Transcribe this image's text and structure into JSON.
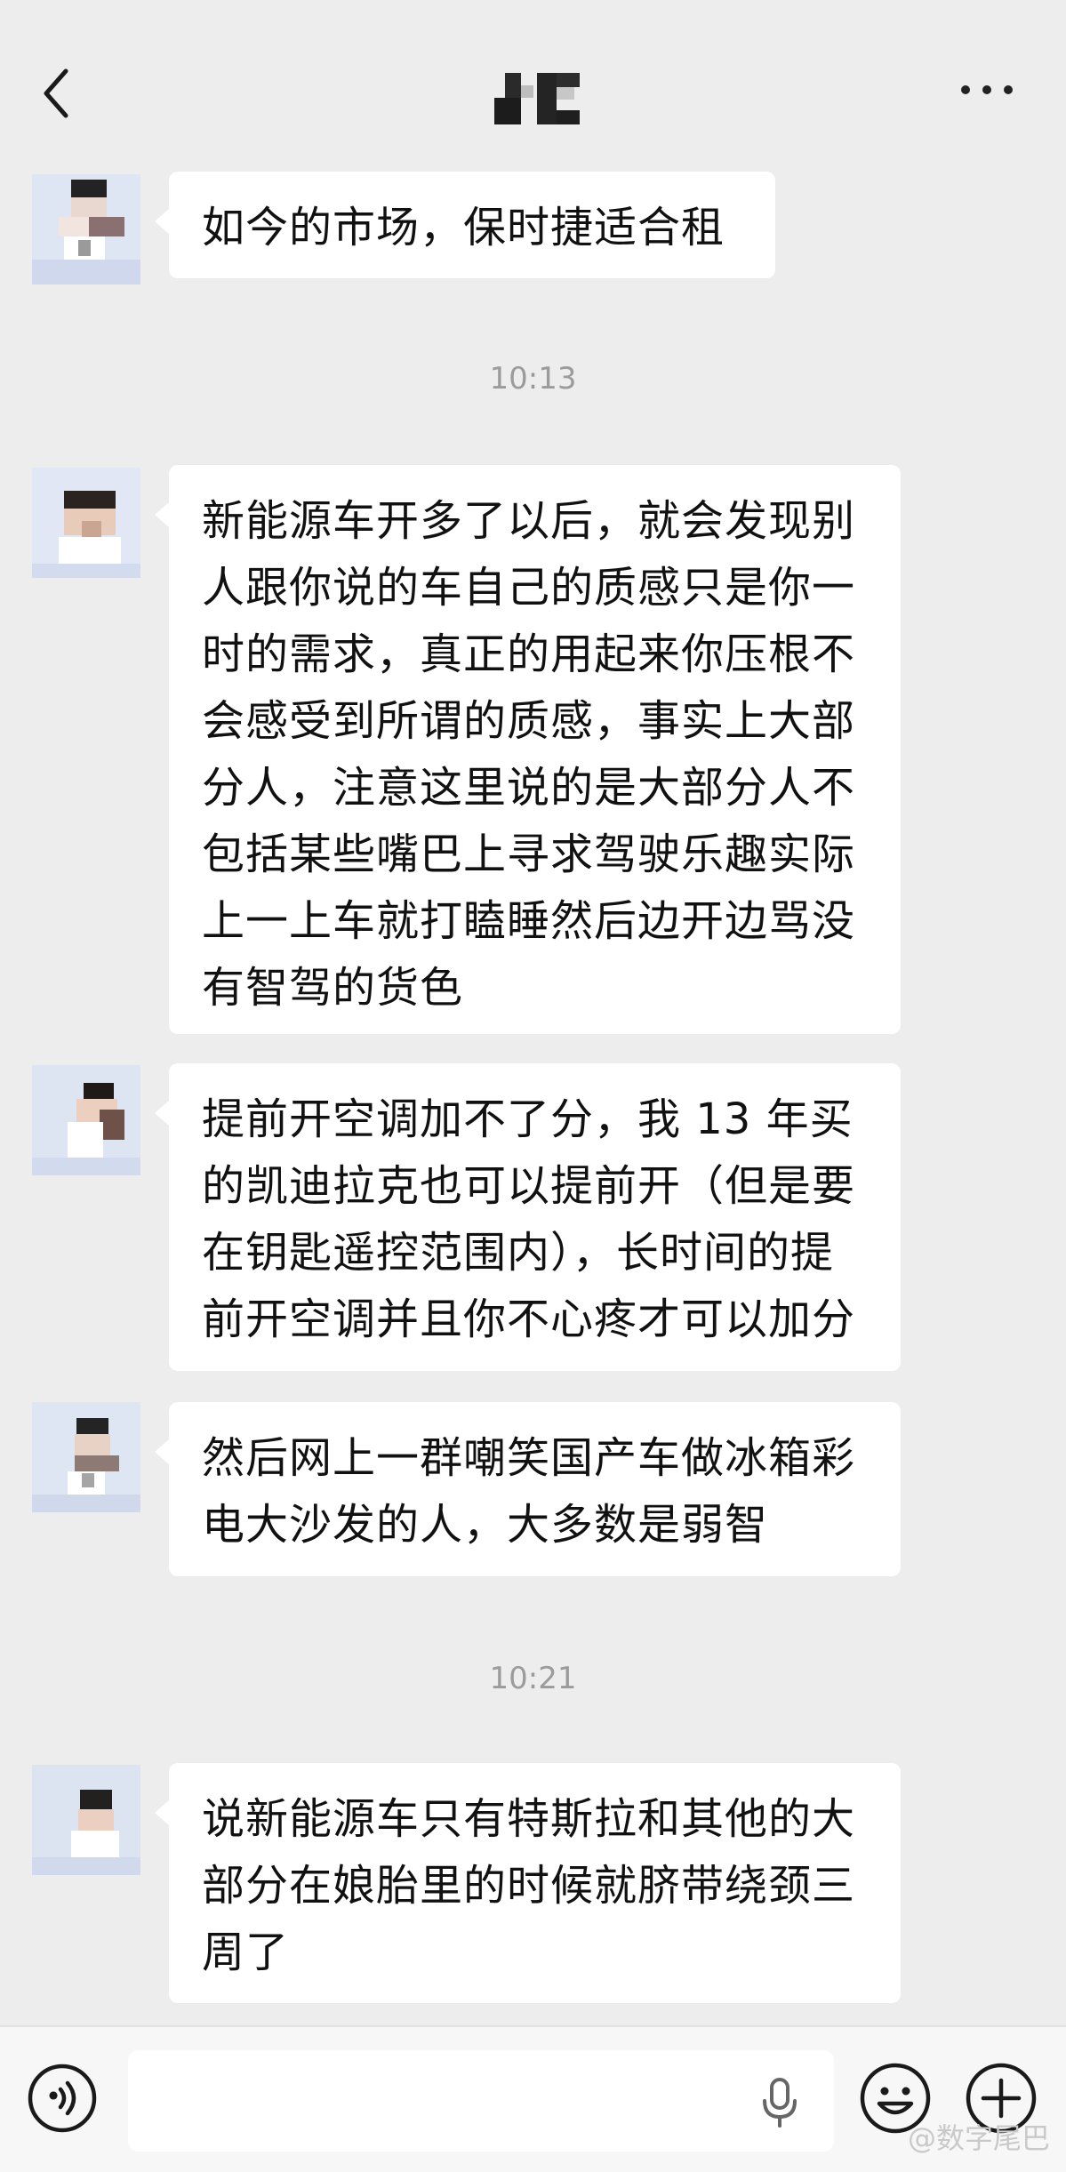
{
  "header": {
    "back_icon": "chevron-left-icon",
    "title_icon": "pixelated-contact-name",
    "more_icon": "more-dots-icon"
  },
  "messages": [
    {
      "text": "如今的市场，保时捷适合租"
    },
    {
      "text": "新能源车开多了以后，就会发现别\n人跟你说的车自己的质感只是你一\n时的需求，真正的用起来你压根不\n会感受到所谓的质感，事实上大部\n分人，注意这里说的是大部分人不\n包括某些嘴巴上寻求驾驶乐趣实际\n上一上车就打瞌睡然后边开边骂没\n有智驾的货色"
    },
    {
      "text": "提前开空调加不了分，我 13 年买\n的凯迪拉克也可以提前开（但是要\n在钥匙遥控范围内），长时间的提\n前开空调并且你不心疼才可以加分"
    },
    {
      "text": "然后网上一群嘲笑国产车做冰箱彩\n电大沙发的人，大多数是弱智"
    },
    {
      "text": "说新能源车只有特斯拉和其他的大\n部分在娘胎里的时候就脐带绕颈三\n周了"
    }
  ],
  "timestamps": [
    "10:13",
    "10:21"
  ],
  "input_bar": {
    "voice_icon": "voice-mode-icon",
    "mic_icon": "microphone-icon",
    "emoji_icon": "emoji-icon",
    "plus_icon": "plus-icon",
    "input_value": ""
  },
  "watermark": "@数字尾巴"
}
